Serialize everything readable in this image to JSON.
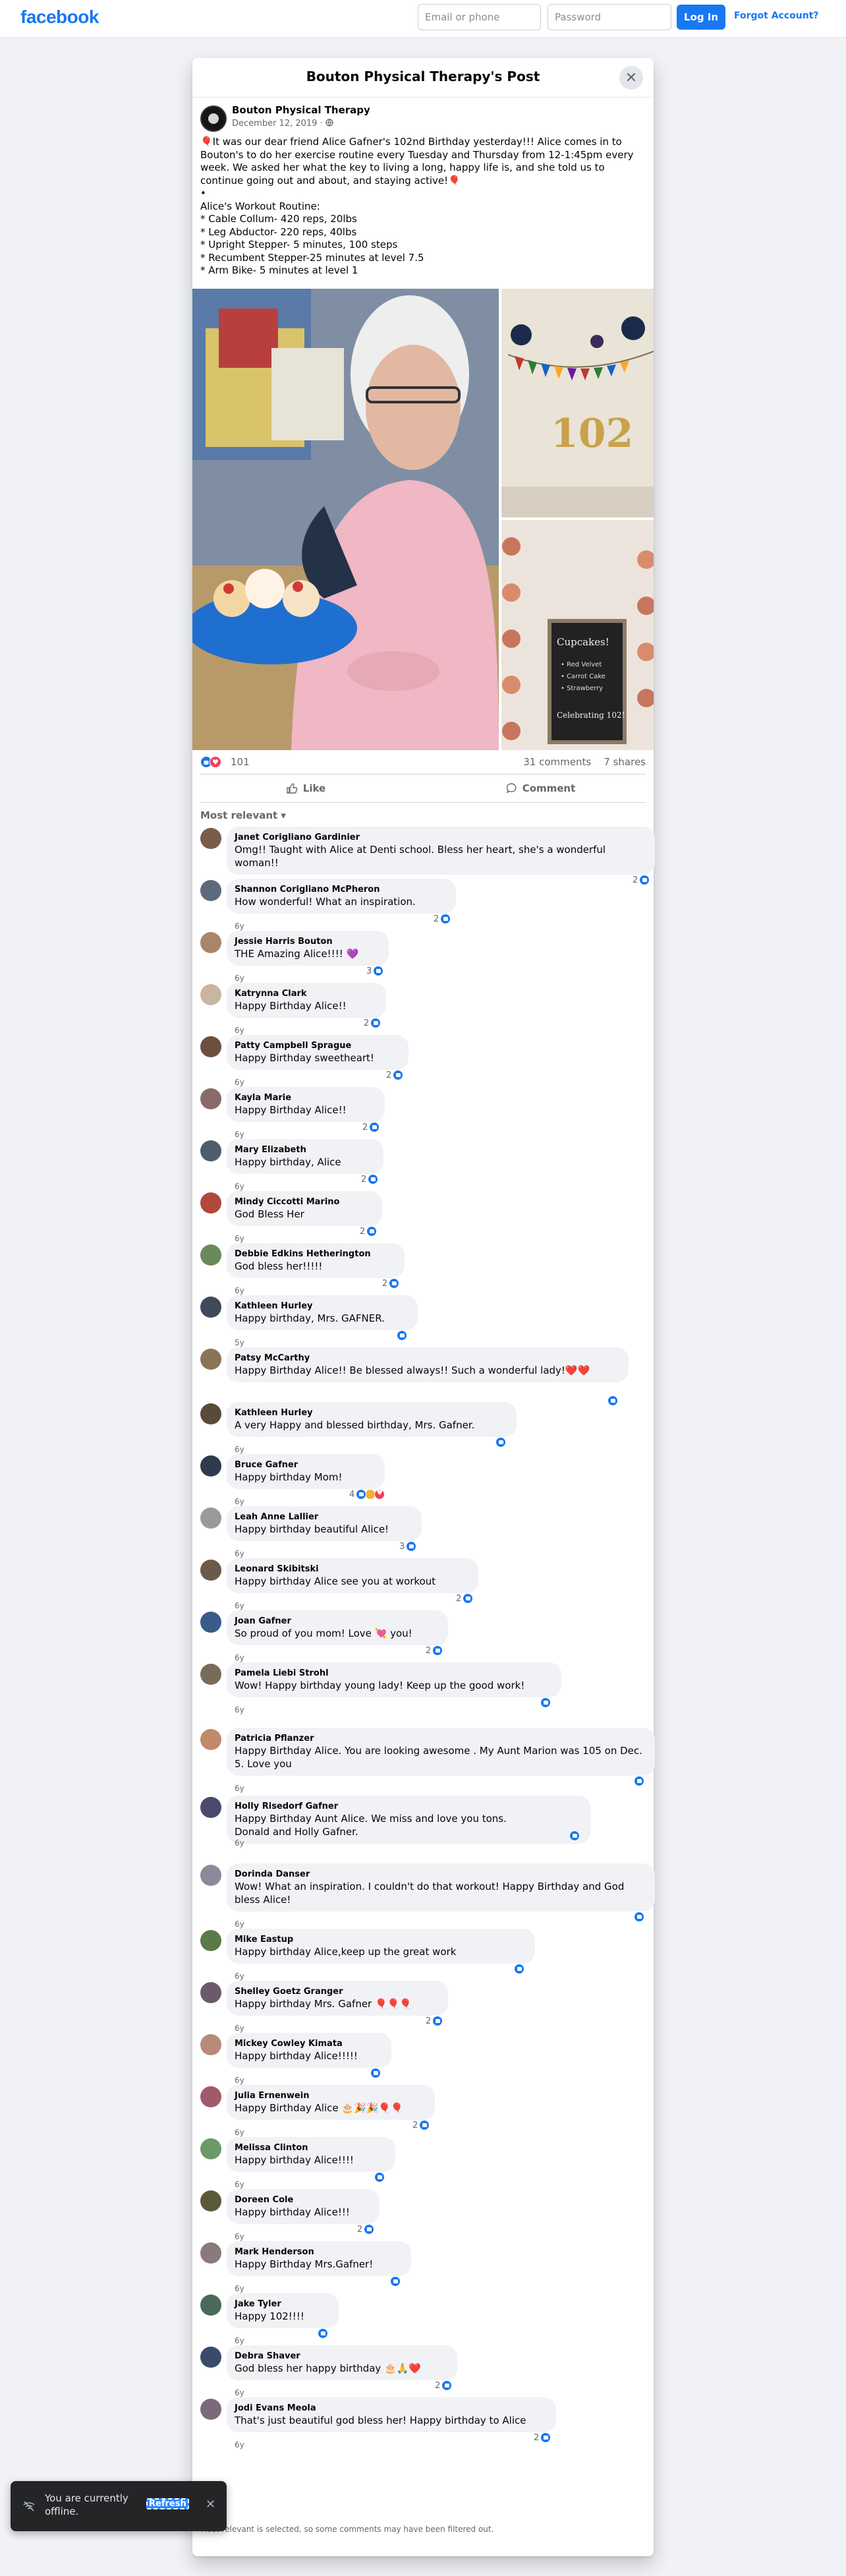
{
  "topbar": {
    "logo": "facebook",
    "email_placeholder": "Email or phone",
    "password_placeholder": "Password",
    "login_label": "Log In",
    "forgot_label": "Forgot Account?"
  },
  "modal": {
    "title": "Bouton Physical Therapy's Post"
  },
  "post": {
    "page_name": "Bouton Physical Therapy",
    "date": "December 12, 2019 · ",
    "text": "🎈It was our dear friend Alice Gafner's 102nd Birthday yesterday!!! Alice comes in to Bouton's to do her exercise routine every Tuesday and Thursday from 12-1:45pm every week. We asked her what the key to living a long, happy life is, and she told us to continue going out and about, and staying active!🎈\n•\nAlice's Workout Routine:\n* Cable Collum- 420 reps, 20lbs\n* Leg Abductor- 220 reps, 40lbs\n* Upright Stepper- 5 minutes, 100 steps\n* Recumbent Stepper-25 minutes at level 7.5\n* Arm Bike- 5 minutes at level 1",
    "reaction_count": "101",
    "comments_count": "31 comments",
    "shares_count": "7 shares",
    "like_label": "Like",
    "comment_label": "Comment",
    "photo_sign_lines": [
      "Cupcakes!",
      "• Red Velvet",
      "• Carrot Cake",
      "• Strawberry",
      "Celebrating 102!"
    ],
    "photo_banner_number": "102"
  },
  "comments_filter": "Most relevant",
  "comments": [
    {
      "name": "Janet Corigliano Gardinier",
      "text": "Omg!! Taught with Alice at Denti school. Bless her heart, she's a wonderful woman!!",
      "age": "6y",
      "count": "2",
      "love": false
    },
    {
      "name": "Shannon Corigliano McPheron",
      "text": "How wonderful! What an inspiration.",
      "age": "6y",
      "count": "2",
      "love": false
    },
    {
      "name": "Jessie Harris Bouton",
      "text": "THE Amazing Alice!!!! 💜",
      "age": "6y",
      "count": "3",
      "love": false
    },
    {
      "name": "Katrynna Clark",
      "text": "Happy Birthday Alice!!",
      "age": "6y",
      "count": "2",
      "love": false
    },
    {
      "name": "Patty Campbell Sprague",
      "text": "Happy Birthday sweetheart!",
      "age": "6y",
      "count": "2",
      "love": false
    },
    {
      "name": "Kayla Marie",
      "text": "Happy Birthday Alice!!",
      "age": "6y",
      "count": "2",
      "love": false
    },
    {
      "name": "Mary Elizabeth",
      "text": "Happy birthday, Alice",
      "age": "6y",
      "count": "2",
      "love": false
    },
    {
      "name": "Mindy Ciccotti Marino",
      "text": "God Bless Her",
      "age": "6y",
      "count": "2",
      "love": false
    },
    {
      "name": "Debbie Edkins Hetherington",
      "text": "God bless her!!!!!",
      "age": "6y",
      "count": "2",
      "love": false
    },
    {
      "name": "Kathleen Hurley",
      "text": "Happy birthday, Mrs. GAFNER.",
      "age": "5y",
      "count": "",
      "love": false
    },
    {
      "name": "Patsy McCarthy",
      "text": "Happy Birthday Alice!! Be blessed always!! Such a wonderful lady!❤️❤️",
      "age": "6y",
      "count": "",
      "love": false
    },
    {
      "name": "Kathleen Hurley",
      "text": "A very Happy and blessed birthday, Mrs. Gafner.",
      "age": "6y",
      "count": "",
      "love": false
    },
    {
      "name": "Bruce Gafner",
      "text": "Happy birthday Mom!",
      "age": "6y",
      "count": "4",
      "love": true
    },
    {
      "name": "Leah Anne Lallier",
      "text": "Happy birthday beautiful Alice!",
      "age": "6y",
      "count": "3",
      "love": false
    },
    {
      "name": "Leonard Skibitski",
      "text": "Happy birthday Alice see you at workout",
      "age": "6y",
      "count": "2",
      "love": false
    },
    {
      "name": "Joan Gafner",
      "text": "So proud of you mom! Love 💘 you!",
      "age": "6y",
      "count": "2",
      "love": false
    },
    {
      "name": "Pamela Liebi Strohl",
      "text": "Wow! Happy birthday young lady! Keep up the good work!",
      "age": "6y",
      "count": "",
      "love": false
    },
    {
      "name": "Patricia Pflanzer",
      "text": "Happy Birthday Alice. You are looking awesome . My Aunt Marion was 105 on Dec. 5. Love you",
      "age": "6y",
      "count": "",
      "love": false
    },
    {
      "name": "Holly Risedorf Gafner",
      "text": "Happy Birthday Aunt Alice. We miss and love you tons.\nDonald and Holly Gafner.",
      "age": "6y",
      "count": "",
      "love": false
    },
    {
      "name": "Dorinda Danser",
      "text": "Wow! What an inspiration. I couldn't do that workout! Happy Birthday and God bless Alice!",
      "age": "6y",
      "count": "",
      "love": false
    },
    {
      "name": "Mike Eastup",
      "text": "Happy birthday Alice,keep up the great work",
      "age": "6y",
      "count": "",
      "love": false
    },
    {
      "name": "Shelley Goetz Granger",
      "text": "Happy birthday Mrs. Gafner 🎈🎈🎈",
      "age": "6y",
      "count": "2",
      "love": false
    },
    {
      "name": "Mickey Cowley Kimata",
      "text": "Happy birthday Alice!!!!!",
      "age": "6y",
      "count": "",
      "love": false
    },
    {
      "name": "Julia Ernenwein",
      "text": "Happy Birthday Alice 🎂🎉🎉🎈🎈",
      "age": "6y",
      "count": "2",
      "love": false
    },
    {
      "name": "Melissa Clinton",
      "text": "Happy birthday Alice!!!!",
      "age": "6y",
      "count": "",
      "love": false
    },
    {
      "name": "Doreen Cole",
      "text": "Happy birthday Alice!!!",
      "age": "6y",
      "count": "2",
      "love": false
    },
    {
      "name": "Mark Henderson",
      "text": "Happy Birthday Mrs.Gafner!",
      "age": "6y",
      "count": "",
      "love": false
    },
    {
      "name": "Jake Tyler",
      "text": "Happy 102!!!!",
      "age": "6y",
      "count": "",
      "love": false
    },
    {
      "name": "Debra Shaver",
      "text": "God bless her happy birthday 🎂🙏❤️",
      "age": "6y",
      "count": "2",
      "love": false
    },
    {
      "name": "Jodi Evans Meola",
      "text": "That's just beautiful god bless her! Happy birthday to Alice",
      "age": "6y",
      "count": "2",
      "love": false
    }
  ],
  "footnote": "Most relevant is selected, so some comments may have been filtered out.",
  "toast": {
    "text": "You are currently offline.",
    "refresh_label": "Refresh"
  },
  "colors": {
    "brand": "#1877f2",
    "background": "#f0f2f5",
    "bubble": "#f0f2f5",
    "secondary_text": "#65676b",
    "toast_bg": "#242526"
  },
  "icons": [
    "close-icon",
    "globe-icon",
    "like-icon",
    "love-icon",
    "comment-icon",
    "chevron-down-icon",
    "wifi-off-icon"
  ]
}
